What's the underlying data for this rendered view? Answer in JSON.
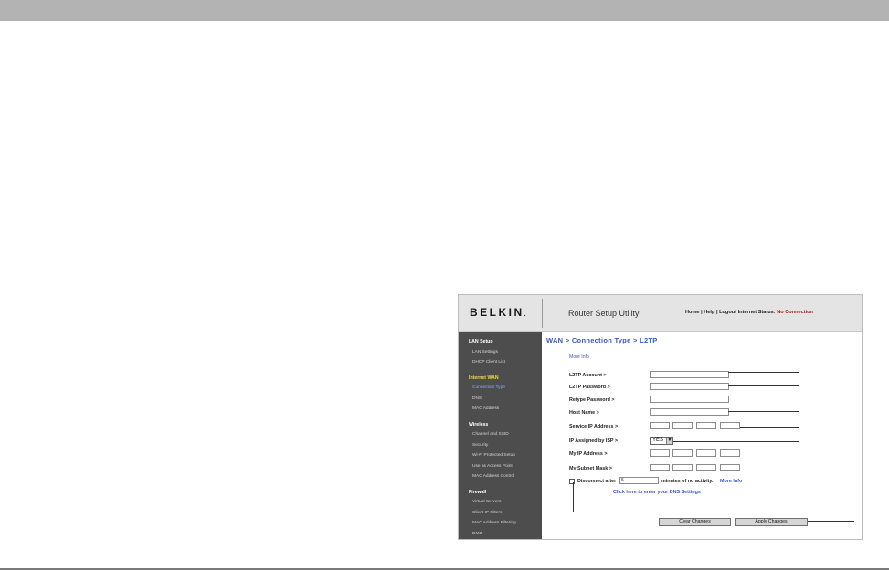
{
  "header": {
    "logo": "BELKIN",
    "logo_suffix": ".",
    "app_title": "Router Setup Utility",
    "links": {
      "home": "Home",
      "help": "Help",
      "logout": "Logout",
      "sep": "|",
      "status_label": "Internet Status:",
      "status_value": "No Connection"
    }
  },
  "sidebar": {
    "sections": [
      {
        "title": "LAN Setup",
        "items": [
          "LAN Settings",
          "DHCP Client List"
        ]
      },
      {
        "title": "Internet WAN",
        "items": [
          "Connection Type",
          "DNS",
          "MAC Address"
        ]
      },
      {
        "title": "Wireless",
        "items": [
          "Channel and SSID",
          "Security",
          "Wi-Fi Protected Setup",
          "Use as Access Point",
          "MAC Address Control"
        ]
      },
      {
        "title": "Firewall",
        "items": [
          "Virtual Servers",
          "Client IP Filters",
          "MAC Address Filtering",
          "DMZ"
        ]
      }
    ],
    "active_section": "Internet WAN",
    "active_item": "Connection Type"
  },
  "main": {
    "breadcrumb": "WAN > Connection Type > L2TP",
    "more_info": "More Info",
    "fields": {
      "l2tp_account": "L2TP Account >",
      "l2tp_password": "L2TP Password >",
      "retype_password": "Retype Password >",
      "host_name": "Host Name >",
      "service_ip": "Service IP Address >",
      "ip_assigned": "IP Assigned by ISP >",
      "my_ip": "My IP Address >",
      "subnet_mask": "My Subnet Mask >"
    },
    "ip_assigned_value": "YES",
    "disconnect_label": "Disconnect after",
    "disconnect_minutes": "5",
    "disconnect_rest": "minutes of no activity.",
    "disconnect_more_info": "More Info",
    "dns_link": "Click here to enter your DNS Settings",
    "buttons": {
      "clear": "Clear Changes",
      "apply": "Apply Changes"
    }
  },
  "colors": {
    "link_blue": "#3a57c9",
    "status_red": "#b01818",
    "sidebar_bg": "#4d4d4d",
    "active_section": "#f2d64b"
  }
}
